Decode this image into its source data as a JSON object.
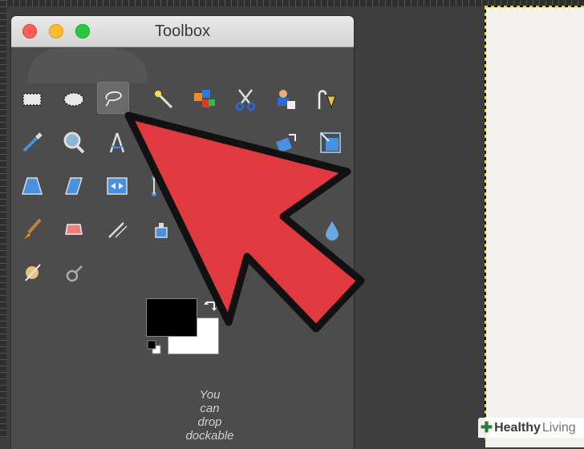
{
  "window": {
    "title": "Toolbox"
  },
  "tools": [
    {
      "name": "rect-select",
      "row": 0,
      "col": 0
    },
    {
      "name": "ellipse-select",
      "row": 0,
      "col": 1
    },
    {
      "name": "free-select",
      "row": 0,
      "col": 2,
      "active": true
    },
    {
      "name": "fuzzy-select",
      "row": 0,
      "col": 3
    },
    {
      "name": "select-by-color",
      "row": 0,
      "col": 4
    },
    {
      "name": "scissors-select",
      "row": 0,
      "col": 5
    },
    {
      "name": "foreground-select",
      "row": 0,
      "col": 6
    },
    {
      "name": "paths",
      "row": 0,
      "col": 7
    },
    {
      "name": "color-picker",
      "row": 1,
      "col": 0
    },
    {
      "name": "zoom",
      "row": 1,
      "col": 1
    },
    {
      "name": "measure",
      "row": 1,
      "col": 2
    },
    {
      "name": "rotate",
      "row": 1,
      "col": 6
    },
    {
      "name": "scale",
      "row": 1,
      "col": 7
    },
    {
      "name": "perspective",
      "row": 2,
      "col": 0
    },
    {
      "name": "shear",
      "row": 2,
      "col": 1
    },
    {
      "name": "flip",
      "row": 2,
      "col": 2
    },
    {
      "name": "cage",
      "row": 2,
      "col": 3
    },
    {
      "name": "paintbrush",
      "row": 3,
      "col": 0
    },
    {
      "name": "eraser",
      "row": 3,
      "col": 1
    },
    {
      "name": "airbrush",
      "row": 3,
      "col": 2
    },
    {
      "name": "ink",
      "row": 3,
      "col": 3
    },
    {
      "name": "blur",
      "row": 3,
      "col": 7
    },
    {
      "name": "dodge-burn",
      "row": 4,
      "col": 0
    },
    {
      "name": "smudge",
      "row": 4,
      "col": 1
    }
  ],
  "colors": {
    "foreground": "#000000",
    "background": "#ffffff",
    "arrow": "#e03a40",
    "canvas": "#f3f2ef"
  },
  "drop_hint": {
    "line1": "You",
    "line2": "can",
    "line3": "drop",
    "line4": "dockable"
  },
  "watermark": {
    "part1": "Healthy",
    "part2": "Living"
  }
}
